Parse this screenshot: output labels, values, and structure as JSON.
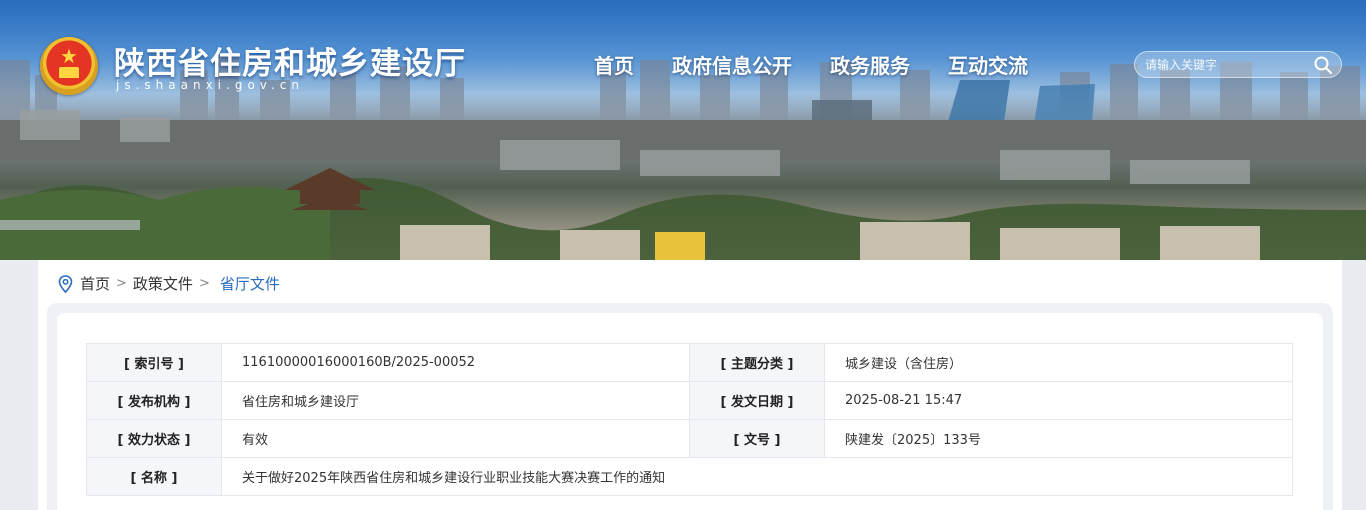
{
  "header": {
    "site_title": "陕西省住房和城乡建设厅",
    "site_domain": "js.shaanxi.gov.cn",
    "nav": [
      "首页",
      "政府信息公开",
      "政务服务",
      "互动交流"
    ],
    "search": {
      "placeholder": "请输入关键字"
    }
  },
  "breadcrumb": {
    "home": "首页",
    "level2": "政策文件",
    "current": "省厅文件",
    "separator": ">"
  },
  "meta": {
    "rows": [
      {
        "k1": "[ 索引号 ]",
        "v1": "11610000016000160B/2025-00052",
        "k2": "[ 主题分类 ]",
        "v2": "城乡建设（含住房）"
      },
      {
        "k1": "[ 发布机构 ]",
        "v1": "省住房和城乡建设厅",
        "k2": "[ 发文日期 ]",
        "v2": "2025-08-21 15:47"
      },
      {
        "k1": "[ 效力状态 ]",
        "v1": "有效",
        "k2": "[ 文号 ]",
        "v2": "陕建发〔2025〕133号"
      }
    ],
    "name_label": "[ 名称 ]",
    "name_value": "关于做好2025年陕西省住房和城乡建设行业职业技能大赛决赛工作的通知"
  },
  "colors": {
    "accent": "#2a6bbf",
    "valid_status": "#1b8f2e",
    "emblem_red": "#e43424"
  },
  "icons": {
    "search": "search-icon",
    "location": "location-pin-icon",
    "emblem": "national-emblem-icon"
  }
}
